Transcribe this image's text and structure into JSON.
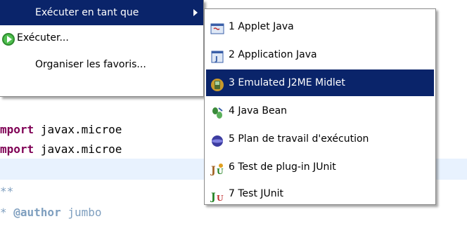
{
  "editor": {
    "lines": [
      {
        "kw": "mport",
        "rest": " javax.microe"
      },
      {
        "kw": "mport",
        "rest": " javax.microe"
      },
      {
        "comment": "**"
      },
      {
        "comment_prefix": "* ",
        "tag": "@author",
        "comment_rest": " jumbo"
      }
    ]
  },
  "main_menu": {
    "items": [
      {
        "label": "Exécuter en tant que",
        "icon": "none",
        "selected": true,
        "has_submenu": true
      },
      {
        "label": "Exécuter...",
        "icon": "run-icon",
        "selected": false
      },
      {
        "label": "Organiser les favoris...",
        "icon": "none",
        "selected": false
      }
    ]
  },
  "sub_menu": {
    "items": [
      {
        "label": "1 Applet Java",
        "icon": "java-applet-icon",
        "selected": false
      },
      {
        "label": "2 Application Java",
        "icon": "java-application-icon",
        "selected": false
      },
      {
        "label": "3 Emulated J2ME Midlet",
        "icon": "j2me-midlet-icon",
        "selected": true
      },
      {
        "label": "4 Java Bean",
        "icon": "java-bean-icon",
        "selected": false
      },
      {
        "label": "5 Plan de travail d'exécution",
        "icon": "workbench-icon",
        "selected": false
      },
      {
        "label": "6 Test de plug-in JUnit",
        "icon": "junit-plugin-icon",
        "selected": false
      },
      {
        "label": "7 Test JUnit",
        "icon": "junit-icon",
        "selected": false
      }
    ]
  },
  "colors": {
    "selection": "#0a246a",
    "keyword": "#7f0055",
    "comment": "#7f9fbf",
    "current_line": "#e8f2fe"
  }
}
